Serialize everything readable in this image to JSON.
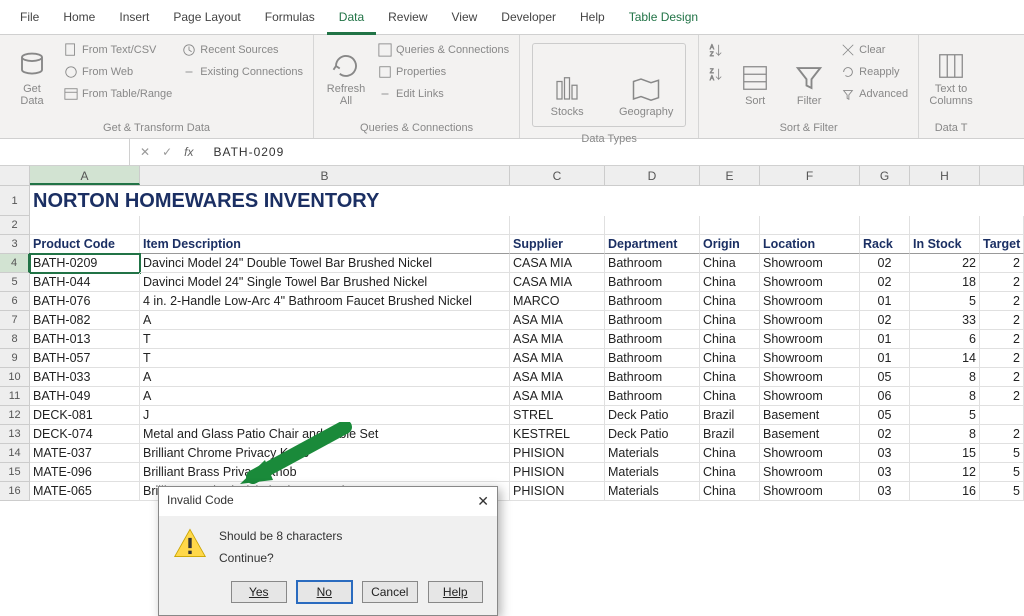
{
  "tabs": {
    "file": "File",
    "home": "Home",
    "insert": "Insert",
    "pagelayout": "Page Layout",
    "formulas": "Formulas",
    "data": "Data",
    "review": "Review",
    "view": "View",
    "developer": "Developer",
    "help": "Help",
    "tabledesign": "Table Design"
  },
  "ribbon": {
    "getdata": "Get\nData",
    "fromtextcsv": "From Text/CSV",
    "fromweb": "From Web",
    "fromtable": "From Table/Range",
    "recentsources": "Recent Sources",
    "existingconn": "Existing Connections",
    "group1": "Get & Transform Data",
    "refreshall": "Refresh\nAll",
    "queries": "Queries & Connections",
    "properties": "Properties",
    "editlinks": "Edit Links",
    "group2": "Queries & Connections",
    "stocks": "Stocks",
    "geography": "Geography",
    "group3": "Data Types",
    "sort": "Sort",
    "filter": "Filter",
    "clear": "Clear",
    "reapply": "Reapply",
    "advanced": "Advanced",
    "group4": "Sort & Filter",
    "texttocol": "Text to\nColumns",
    "group5": "Data T"
  },
  "formula_bar": {
    "namebox": "",
    "value": "BATH-0209"
  },
  "colheads": [
    "A",
    "B",
    "C",
    "D",
    "E",
    "F",
    "G",
    "H"
  ],
  "title": "NORTON HOMEWARES INVENTORY",
  "headers": {
    "code": "Product Code",
    "desc": "Item Description",
    "supp": "Supplier",
    "dept": "Department",
    "orig": "Origin",
    "loc": "Location",
    "rack": "Rack",
    "stock": "In Stock",
    "target": "Target"
  },
  "rows": [
    {
      "n": "4",
      "code": "BATH-0209",
      "desc": "Davinci Model 24\" Double Towel Bar Brushed Nickel",
      "supp": "CASA MIA",
      "dept": "Bathroom",
      "orig": "China",
      "loc": "Showroom",
      "rack": "02",
      "stock": "22",
      "target": "2"
    },
    {
      "n": "5",
      "code": "BATH-044",
      "desc": "Davinci Model 24\" Single Towel Bar Brushed Nickel",
      "supp": "CASA MIA",
      "dept": "Bathroom",
      "orig": "China",
      "loc": "Showroom",
      "rack": "02",
      "stock": "18",
      "target": "2"
    },
    {
      "n": "6",
      "code": "BATH-076",
      "desc": "4 in. 2-Handle Low-Arc 4\" Bathroom Faucet Brushed Nickel",
      "supp": "MARCO",
      "dept": "Bathroom",
      "orig": "China",
      "loc": "Showroom",
      "rack": "01",
      "stock": "5",
      "target": "2"
    },
    {
      "n": "7",
      "code": "BATH-082",
      "desc": "A",
      "supp": "ASA MIA",
      "dept": "Bathroom",
      "orig": "China",
      "loc": "Showroom",
      "rack": "02",
      "stock": "33",
      "target": "2"
    },
    {
      "n": "8",
      "code": "BATH-013",
      "desc": "T",
      "supp": "ASA MIA",
      "dept": "Bathroom",
      "orig": "China",
      "loc": "Showroom",
      "rack": "01",
      "stock": "6",
      "target": "2"
    },
    {
      "n": "9",
      "code": "BATH-057",
      "desc": "T",
      "supp": "ASA MIA",
      "dept": "Bathroom",
      "orig": "China",
      "loc": "Showroom",
      "rack": "01",
      "stock": "14",
      "target": "2"
    },
    {
      "n": "10",
      "code": "BATH-033",
      "desc": "A",
      "supp": "ASA MIA",
      "dept": "Bathroom",
      "orig": "China",
      "loc": "Showroom",
      "rack": "05",
      "stock": "8",
      "target": "2"
    },
    {
      "n": "11",
      "code": "BATH-049",
      "desc": "A",
      "supp": "ASA MIA",
      "dept": "Bathroom",
      "orig": "China",
      "loc": "Showroom",
      "rack": "06",
      "stock": "8",
      "target": "2"
    },
    {
      "n": "12",
      "code": "DECK-081",
      "desc": "J",
      "supp": "STREL",
      "dept": "Deck Patio",
      "orig": "Brazil",
      "loc": "Basement",
      "rack": "05",
      "stock": "5",
      "target": ""
    },
    {
      "n": "13",
      "code": "DECK-074",
      "desc": "Metal and Glass Patio Chair and Table Set",
      "supp": "KESTREL",
      "dept": "Deck Patio",
      "orig": "Brazil",
      "loc": "Basement",
      "rack": "02",
      "stock": "8",
      "target": "2"
    },
    {
      "n": "14",
      "code": "MATE-037",
      "desc": "Brilliant Chrome Privacy Knob",
      "supp": "PHISION",
      "dept": "Materials",
      "orig": "China",
      "loc": "Showroom",
      "rack": "03",
      "stock": "15",
      "target": "5"
    },
    {
      "n": "15",
      "code": "MATE-096",
      "desc": "Brilliant Brass Privacy Knob",
      "supp": "PHISION",
      "dept": "Materials",
      "orig": "China",
      "loc": "Showroom",
      "rack": "03",
      "stock": "12",
      "target": "5"
    },
    {
      "n": "16",
      "code": "MATE-065",
      "desc": "Brilliant Brushed Nickel Privacy Knob",
      "supp": "PHISION",
      "dept": "Materials",
      "orig": "China",
      "loc": "Showroom",
      "rack": "03",
      "stock": "16",
      "target": "5"
    }
  ],
  "dialog": {
    "title": "Invalid Code",
    "msg1": "Should be 8 characters",
    "msg2": "Continue?",
    "yes": "Yes",
    "no": "No",
    "cancel": "Cancel",
    "help": "Help"
  }
}
